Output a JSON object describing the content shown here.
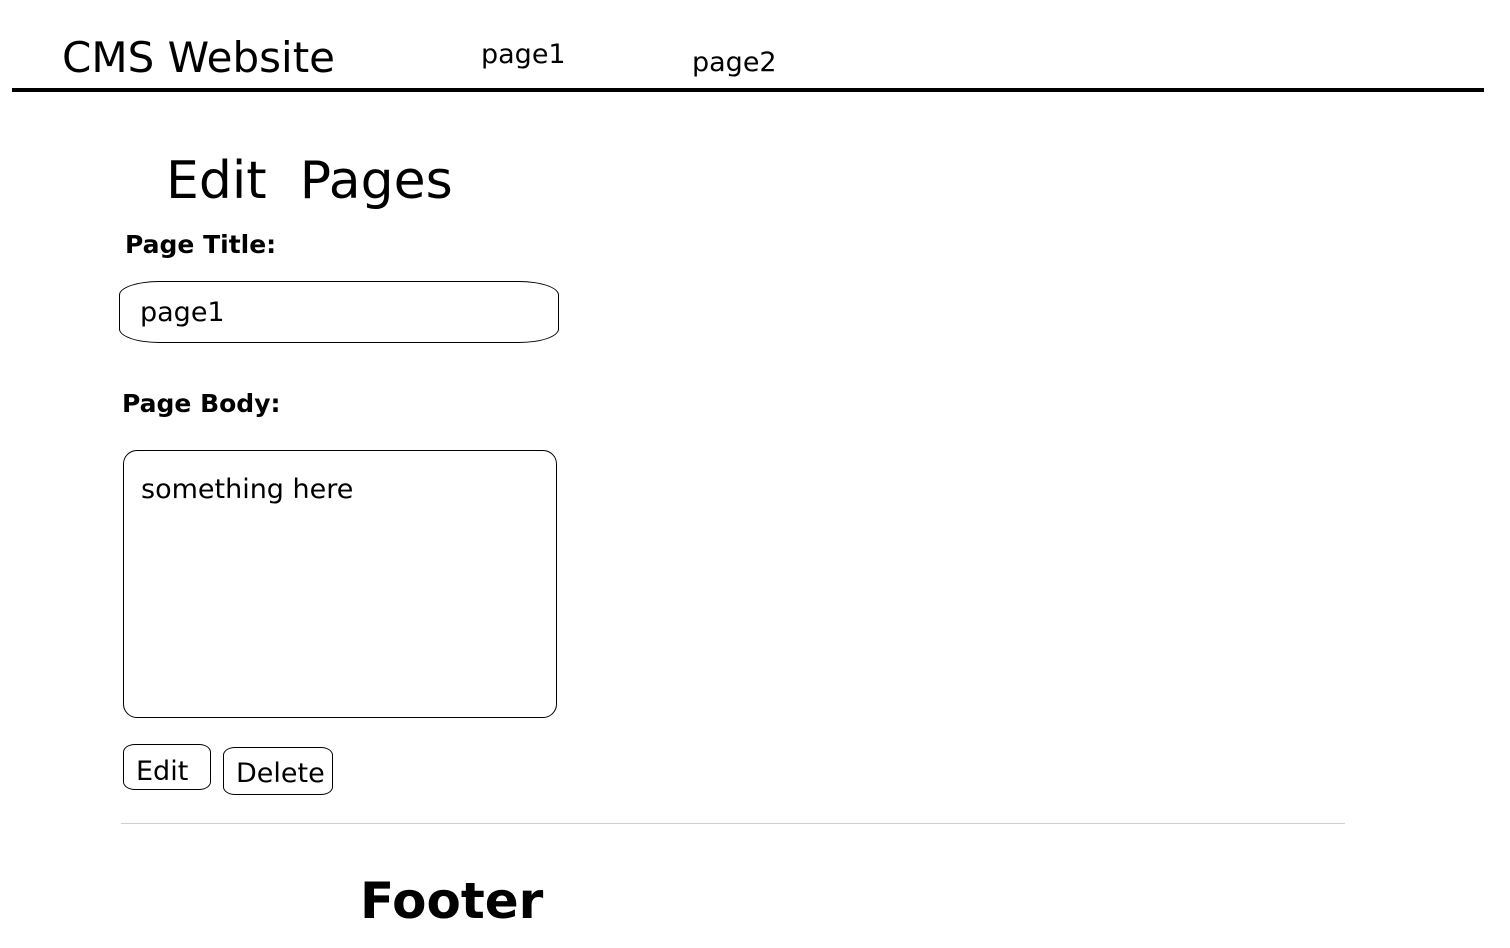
{
  "header": {
    "site_title": "CMS Website",
    "nav": [
      {
        "label": "page1"
      },
      {
        "label": "page2"
      }
    ]
  },
  "main": {
    "heading": "Edit  Pages",
    "title_field": {
      "label": "Page Title:",
      "value": "page1"
    },
    "body_field": {
      "label": "Page Body:",
      "value": "something here"
    },
    "buttons": {
      "edit_label": "Edit",
      "delete_label": "Delete"
    }
  },
  "footer": {
    "text": "Footer"
  }
}
